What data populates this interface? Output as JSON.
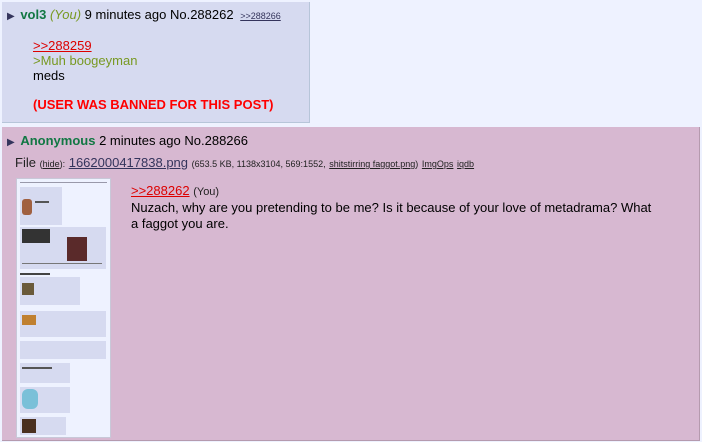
{
  "post1": {
    "arrow": "▶",
    "name": "vol3",
    "you": "(You)",
    "time": "9 minutes ago",
    "number": "No.288262",
    "backlink": ">>288266",
    "quote": ">>288259",
    "greentext": ">Muh boogeyman",
    "text": "meds",
    "banned": "(USER WAS BANNED FOR THIS POST)"
  },
  "post2": {
    "arrow": "▶",
    "name": "Anonymous",
    "time": "2 minutes ago",
    "number": "No.288266",
    "file_label": "File",
    "hide": "hide",
    "filename": "1662000417838.png",
    "file_info": "(653.5 KB, 1138x3104, 569:1552,",
    "orig_name": "shitstirring faggot.png",
    "imgops": "ImgOps",
    "iqdb": "iqdb",
    "quote": ">>288262",
    "quote_you": "(You)",
    "text_line1": "Nuzach, why are you pretending to be me? Is it because of your love of metadrama? What",
    "text_line2": "a faggot you are."
  },
  "colors": {
    "post_bg": "#d6daf0",
    "highlight_bg": "#d7b8d1",
    "name": "#117743",
    "quote": "#dd0000",
    "greentext": "#789922",
    "banned": "#ff0000"
  }
}
